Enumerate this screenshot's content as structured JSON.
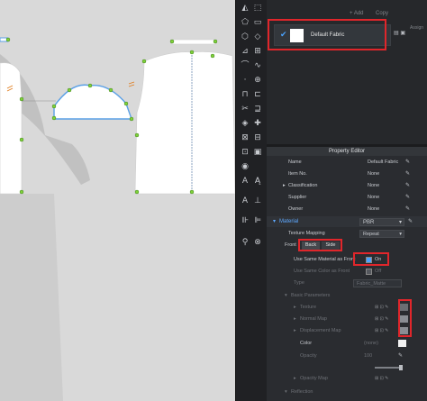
{
  "toolbar_top": {
    "add_label": "+ Add",
    "copy_label": "Copy",
    "assign_label": "Assign"
  },
  "object_browser": {
    "fabric_name": "Default Fabric"
  },
  "property_editor": {
    "title": "Property Editor",
    "rows": [
      {
        "label": "Name",
        "value": "Default Fabric"
      },
      {
        "label": "Item No.",
        "value": "None"
      },
      {
        "label": "Classification",
        "value": "None"
      },
      {
        "label": "Supplier",
        "value": "None"
      },
      {
        "label": "Owner",
        "value": "None"
      }
    ],
    "material": {
      "label": "Material",
      "type_value": "PBR",
      "texture_mapping_label": "Texture Mapping",
      "texture_mapping_value": "Repeat",
      "front_label": "Front",
      "back_label": "Back",
      "side_label": "Side",
      "same_material_label": "Use Same Material as Front",
      "same_material_value": "On",
      "same_color_label": "Use Same Color as Front",
      "same_color_value": "Off",
      "type_label": "Type",
      "type_field": "Fabric_Matte",
      "basic_params_label": "Basic Parameters",
      "texture_label": "Texture",
      "normal_map_label": "Normal Map",
      "displacement_map_label": "Displacement Map",
      "color_label": "Color",
      "color_value": "(none)",
      "opacity_label": "Opacity",
      "opacity_value": "100",
      "opacity_map_label": "Opacity Map",
      "reflection_label": "Reflection"
    }
  },
  "colors": {
    "highlight": "#e0262b",
    "check": "#4aa3ff",
    "seam": "#5aa0e6",
    "point": "#7fd13a"
  }
}
